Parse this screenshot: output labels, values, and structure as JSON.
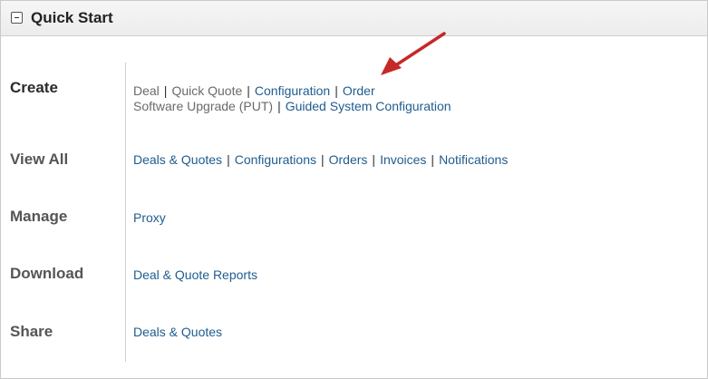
{
  "header": {
    "title": "Quick Start",
    "collapse_symbol": "minus-icon"
  },
  "rows": {
    "create": {
      "label": "Create",
      "links": [
        "Deal",
        "Quick Quote",
        "Configuration",
        "Order",
        "Software Upgrade (PUT)",
        "Guided System Configuration"
      ]
    },
    "view_all": {
      "label": "View All",
      "links": [
        "Deals & Quotes",
        "Configurations",
        "Orders",
        "Invoices",
        "Notifications"
      ]
    },
    "manage": {
      "label": "Manage",
      "links": [
        "Proxy"
      ]
    },
    "download": {
      "label": "Download",
      "links": [
        "Deal & Quote Reports"
      ]
    },
    "share": {
      "label": "Share",
      "links": [
        "Deals & Quotes"
      ]
    }
  },
  "colors": {
    "link": "#1f5c8f",
    "disabled_link": "#6a6a6a",
    "arrow": "#c62828"
  }
}
